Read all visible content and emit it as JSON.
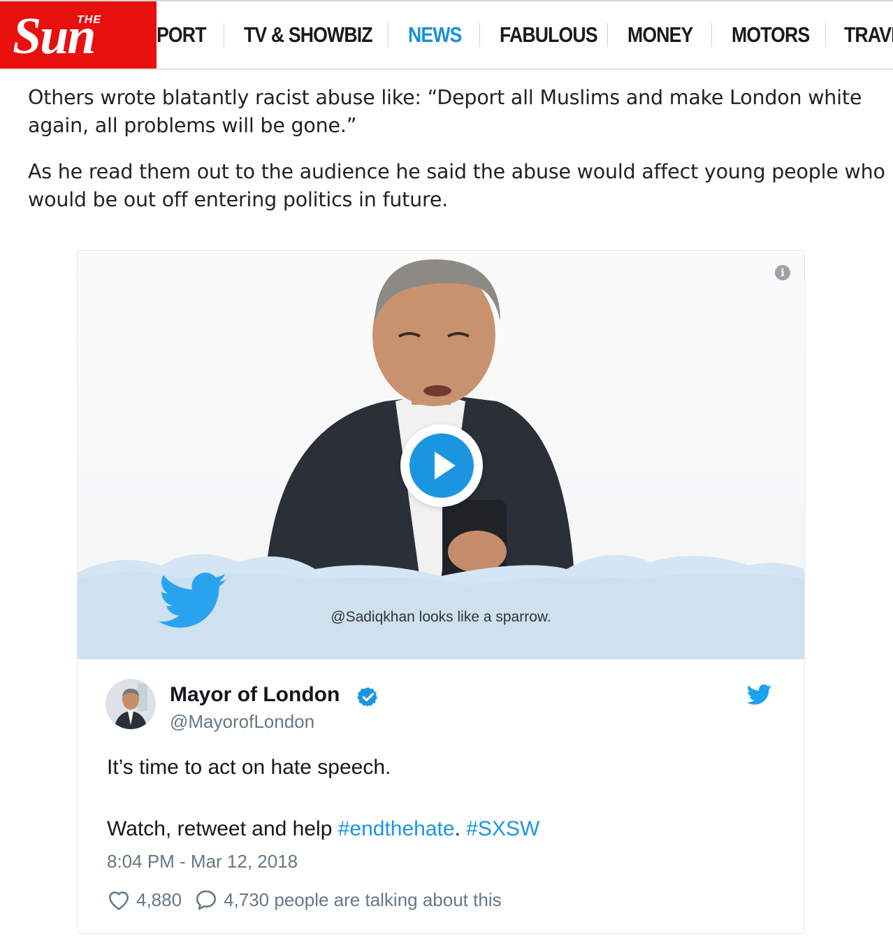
{
  "header": {
    "logo_the": "THE",
    "logo_sun": "Sun",
    "nav": [
      {
        "label": "PORT",
        "active": false
      },
      {
        "label": "TV & SHOWBIZ",
        "active": false
      },
      {
        "label": "NEWS",
        "active": true
      },
      {
        "label": "FABULOUS",
        "active": false
      },
      {
        "label": "MONEY",
        "active": false
      },
      {
        "label": "MOTORS",
        "active": false
      },
      {
        "label": "TRAVE",
        "active": false
      }
    ]
  },
  "article": {
    "paragraphs": [
      [
        "Others wrote blatantly racist abuse like: “Deport all Muslims and make London white",
        "again, all problems will be gone.”"
      ],
      [
        "As he read them out to the audience he said the abuse would affect young people who",
        "would be out off entering politics in future."
      ]
    ]
  },
  "embed": {
    "video": {
      "caption": "@Sadiqkhan looks like a sparrow."
    },
    "tweet": {
      "author": "Mayor of London",
      "handle": "@MayorofLondon",
      "text_line1": "It’s time to act on hate speech.",
      "text_line2_prefix": "Watch, retweet and help ",
      "hashtag1": "#endthehate",
      "separator": ". ",
      "hashtag2": "#SXSW",
      "timestamp": "8:04 PM - Mar 12, 2018",
      "likes": "4,880",
      "replies_text": "4,730 people are talking about this"
    }
  },
  "colors": {
    "brand_red": "#e80f0f",
    "nav_active": "#1a8fd8",
    "twitter_blue": "#1b95e0",
    "muted": "#657786"
  },
  "icons": {
    "info": "info-icon",
    "play": "play-icon",
    "twitter_bird": "twitter-bird-icon",
    "verified": "verified-badge-icon",
    "heart": "heart-icon",
    "comment": "comment-icon"
  }
}
